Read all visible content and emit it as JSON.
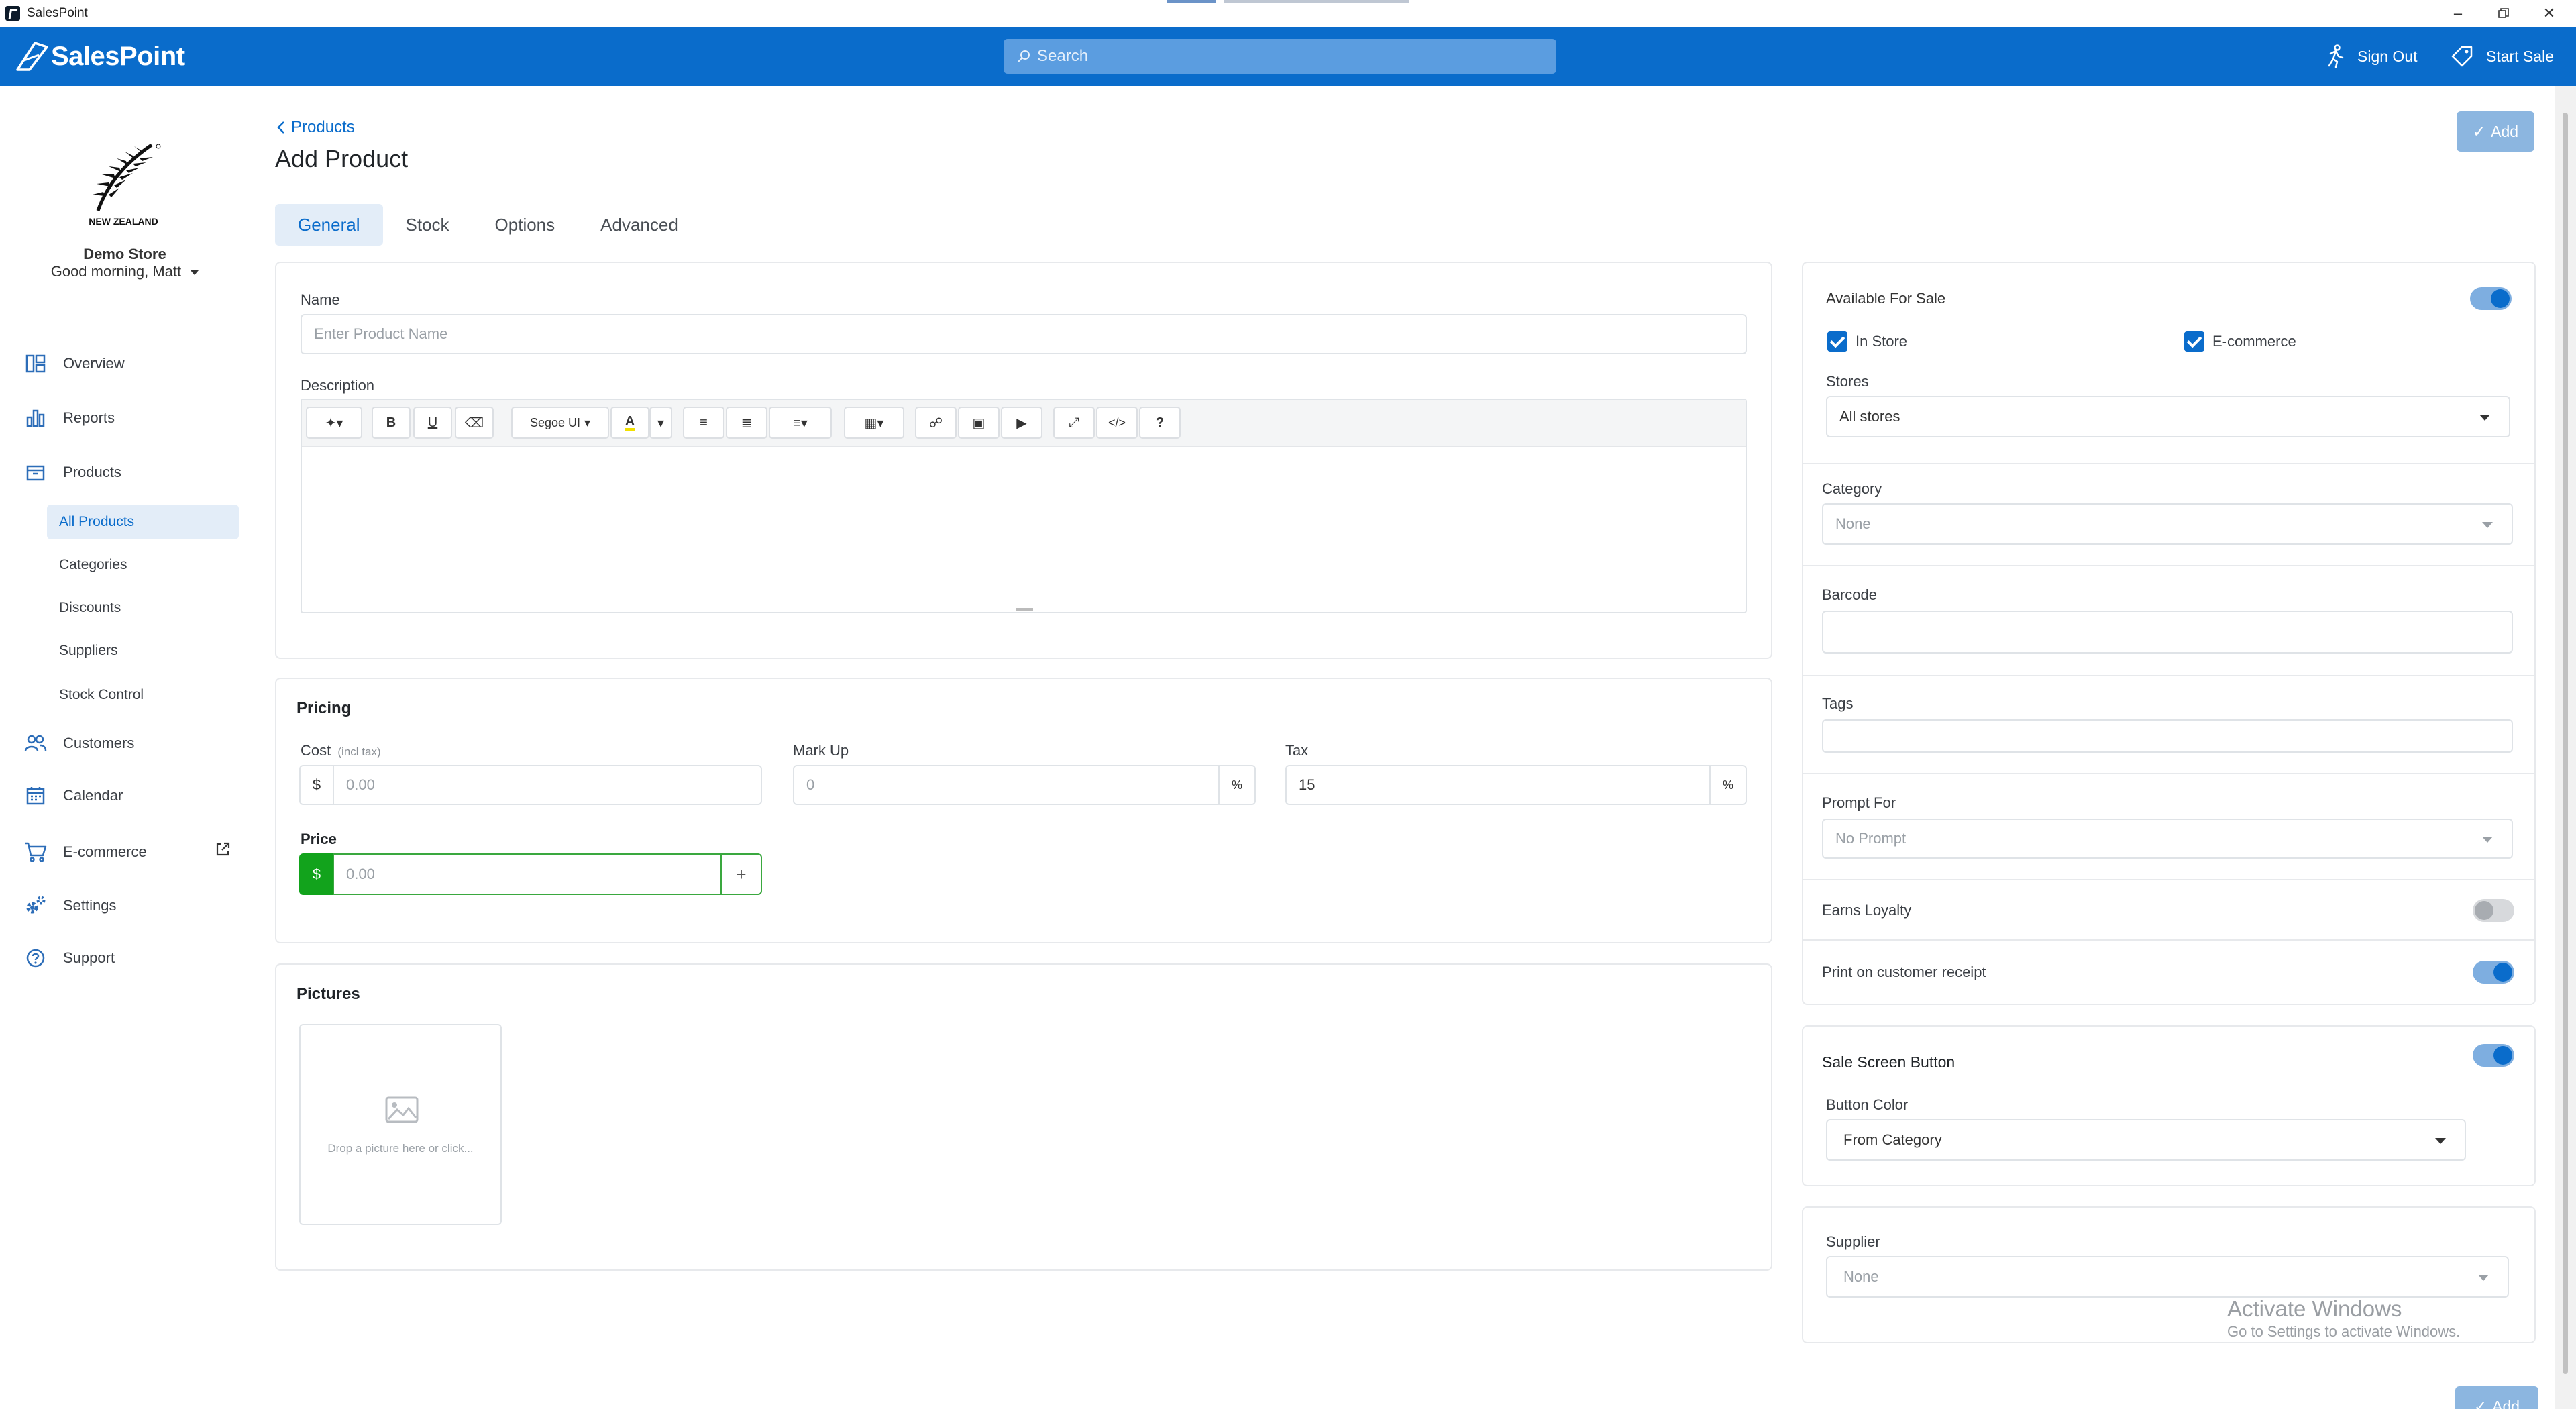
{
  "window": {
    "title": "SalesPoint"
  },
  "topbar": {
    "logo_text": "SalesPoint",
    "search_placeholder": "Search",
    "sign_out": "Sign Out",
    "start_sale": "Start Sale"
  },
  "sidebar": {
    "brand_caption": "NEW ZEALAND",
    "store_name": "Demo Store",
    "greeting": "Good morning, Matt",
    "nav": {
      "overview": "Overview",
      "reports": "Reports",
      "products": "Products",
      "customers": "Customers",
      "calendar": "Calendar",
      "ecommerce": "E-commerce",
      "settings": "Settings",
      "support": "Support"
    },
    "products_sub": {
      "all_products": "All Products",
      "categories": "Categories",
      "discounts": "Discounts",
      "suppliers": "Suppliers",
      "stock_control": "Stock Control"
    }
  },
  "page": {
    "breadcrumb": "Products",
    "title": "Add Product",
    "add_button": "Add",
    "tabs": {
      "general": "General",
      "stock": "Stock",
      "options": "Options",
      "advanced": "Advanced"
    }
  },
  "general": {
    "name_label": "Name",
    "name_placeholder": "Enter Product Name",
    "description_label": "Description",
    "editor_font": "Segoe UI"
  },
  "pricing": {
    "title": "Pricing",
    "cost_label": "Cost",
    "cost_hint": "(incl tax)",
    "currency": "$",
    "cost_placeholder": "0.00",
    "markup_label": "Mark Up",
    "markup_placeholder": "0",
    "percent": "%",
    "tax_label": "Tax",
    "tax_value": "15",
    "price_label": "Price",
    "price_placeholder": "0.00",
    "plus": "+"
  },
  "pictures": {
    "title": "Pictures",
    "drop_text": "Drop a picture here or click..."
  },
  "side": {
    "available_for_sale": "Available For Sale",
    "available_on": true,
    "in_store": "In Store",
    "ecommerce": "E-commerce",
    "stores_label": "Stores",
    "stores_value": "All stores",
    "category_label": "Category",
    "category_value": "None",
    "barcode_label": "Barcode",
    "tags_label": "Tags",
    "prompt_for_label": "Prompt For",
    "prompt_for_value": "No Prompt",
    "earns_loyalty": "Earns Loyalty",
    "earns_loyalty_on": false,
    "print_receipt": "Print on customer receipt",
    "print_receipt_on": true,
    "sale_screen_button": "Sale Screen Button",
    "sale_screen_on": true,
    "button_color_label": "Button Color",
    "button_color_value": "From Category",
    "supplier_label": "Supplier",
    "supplier_value": "None"
  },
  "watermark": {
    "line1": "Activate Windows",
    "line2": "Go to Settings to activate Windows."
  }
}
